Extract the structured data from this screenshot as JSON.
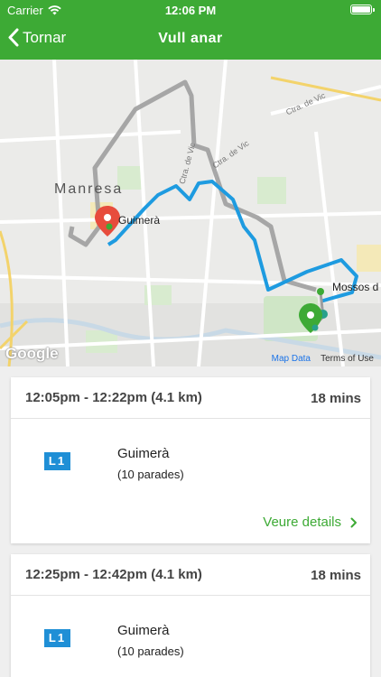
{
  "status_bar": {
    "carrier": "Carrier",
    "time": "12:06 PM"
  },
  "nav": {
    "back_label": "Tornar",
    "title": "Vull anar"
  },
  "map": {
    "city_label": "Manresa",
    "origin_label": "Guimerà",
    "destination_label": "Mossos d",
    "road_labels": [
      "Ctra. de Vic",
      "Ctra. de Vic",
      "Ctra. de Vic"
    ],
    "logo": "Google",
    "map_data": "Map Data",
    "terms": "Terms of Use",
    "route_color": "#1e9be0",
    "walk_color": "#9e9e9e"
  },
  "routes": [
    {
      "time_range": "12:05pm - 12:22pm (4.1 km)",
      "duration": "18 mins",
      "line": "L1",
      "stop": "Guimerà",
      "stops": "(10 parades)",
      "details_label": "Veure details"
    },
    {
      "time_range": "12:25pm - 12:42pm (4.1 km)",
      "duration": "18 mins",
      "line": "L1",
      "stop": "Guimerà",
      "stops": "(10 parades)"
    }
  ],
  "colors": {
    "brand_green": "#3daa35",
    "line_blue": "#1f8fd6",
    "pin_red": "#e74c3c"
  }
}
